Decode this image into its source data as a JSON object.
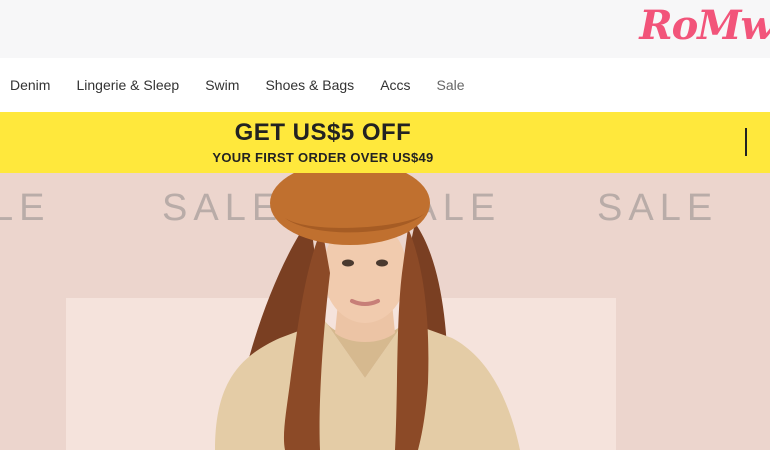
{
  "header": {
    "logo_text": "RoMw"
  },
  "nav": {
    "items": [
      {
        "label": "Denim"
      },
      {
        "label": "Lingerie & Sleep"
      },
      {
        "label": "Swim"
      },
      {
        "label": "Shoes & Bags"
      },
      {
        "label": "Accs"
      },
      {
        "label": "Sale"
      }
    ]
  },
  "promo": {
    "headline": "GET US$5 OFF",
    "subline": "YOUR FIRST ORDER OVER US$49"
  },
  "hero": {
    "sale_words": [
      "LE",
      "SALE",
      "SALE",
      "SALE"
    ],
    "colors": {
      "background": "#ecd5cd",
      "panel": "#f5e3dc",
      "sale_text": "#b9aca8"
    }
  },
  "colors": {
    "brand": "#f2547a",
    "promo_bg": "#ffe83c"
  }
}
